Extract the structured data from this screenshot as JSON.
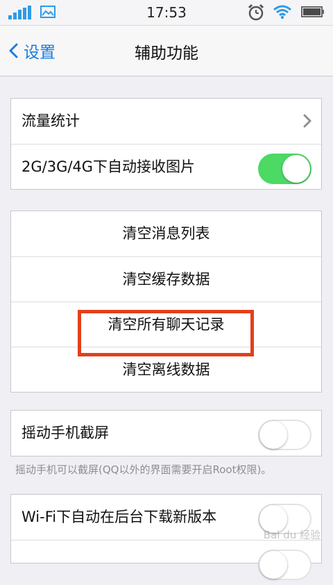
{
  "status_bar": {
    "time": "17:53",
    "signal_color": "#2e9be6",
    "icons": [
      "signal-icon",
      "picture-icon",
      "alarm-icon",
      "wifi-icon",
      "battery-icon"
    ]
  },
  "nav": {
    "back_label": "设置",
    "title": "辅助功能",
    "accent_color": "#1a7ce0"
  },
  "group1": {
    "traffic_label": "流量统计",
    "auto_receive_label": "2G/3G/4G下自动接收图片",
    "auto_receive_on": true
  },
  "group2": {
    "items": [
      "清空消息列表",
      "清空缓存数据",
      "清空所有聊天记录",
      "清空离线数据"
    ],
    "highlight_color": "#e2401c"
  },
  "group3": {
    "shake_label": "摇动手机截屏",
    "shake_on": false,
    "footnote": "摇动手机可以截屏(QQ以外的界面需要开启Root权限)。"
  },
  "group4": {
    "wifi_update_label": "Wi-Fi下自动在后台下载新版本",
    "wifi_update_on": false
  },
  "toggle_on_color": "#4cd964",
  "watermark": "Bai du 经验"
}
